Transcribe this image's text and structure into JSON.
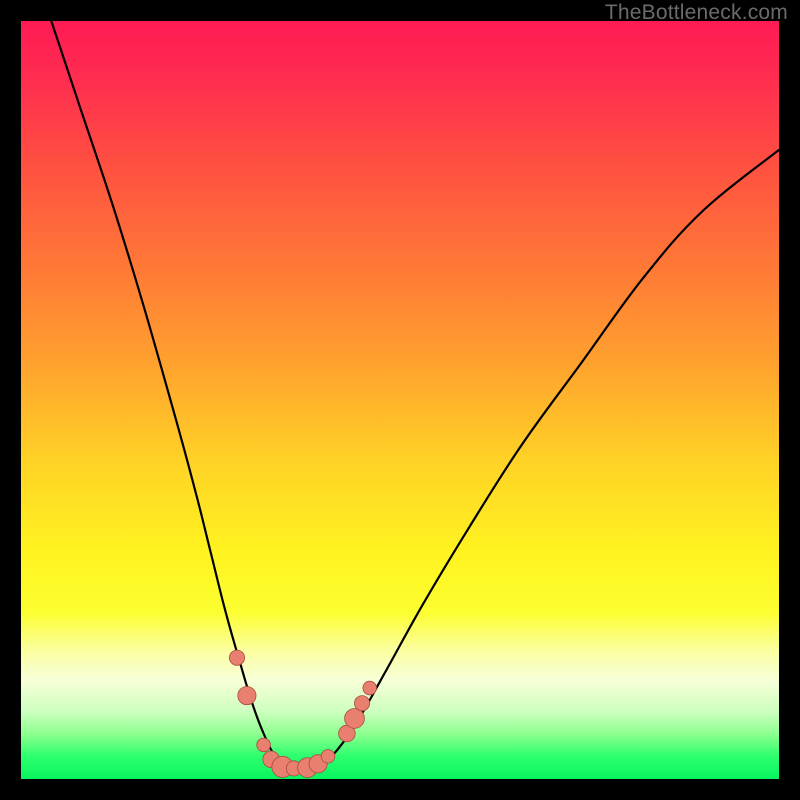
{
  "watermark": "TheBottleneck.com",
  "colors": {
    "frame": "#000000",
    "curve": "#000000",
    "marker_fill": "#e9806f",
    "marker_stroke": "#a84a3d",
    "gradient_stops": [
      "#ff1a54",
      "#ff2e4f",
      "#ff5340",
      "#ff7a36",
      "#ffa12e",
      "#ffd226",
      "#fff320",
      "#fcfe30",
      "#fbffa0",
      "#f7ffd8",
      "#cfffc0",
      "#8fff90",
      "#2dff6e",
      "#07f55f"
    ]
  },
  "chart_data": {
    "type": "line",
    "title": "",
    "xlabel": "",
    "ylabel": "",
    "xlim": [
      0,
      100
    ],
    "ylim": [
      0,
      100
    ],
    "note": "x,y in percent of plot area; y=0 at bottom (green), y=100 at top (red). Background gradient encodes bottleneck severity: green=balanced, red=severe.",
    "series": [
      {
        "name": "bottleneck-curve",
        "x": [
          4,
          8,
          12,
          16,
          20,
          23,
          25,
          27,
          29,
          30.5,
          32,
          33.5,
          35,
          37,
          39,
          41,
          44,
          48,
          53,
          59,
          66,
          74,
          82,
          90,
          100
        ],
        "y": [
          100,
          88,
          76,
          63,
          49,
          38,
          30,
          22,
          15,
          10,
          6,
          3,
          1.5,
          1.3,
          1.5,
          3,
          7,
          14,
          23,
          33,
          44,
          55,
          66,
          75,
          83
        ]
      }
    ],
    "markers": {
      "name": "sample-points",
      "points": [
        {
          "x": 28.5,
          "y": 16,
          "r": 1.0
        },
        {
          "x": 29.8,
          "y": 11,
          "r": 1.2
        },
        {
          "x": 32.0,
          "y": 4.5,
          "r": 0.9
        },
        {
          "x": 33.0,
          "y": 2.6,
          "r": 1.1
        },
        {
          "x": 34.5,
          "y": 1.6,
          "r": 1.4
        },
        {
          "x": 36.0,
          "y": 1.4,
          "r": 1.0
        },
        {
          "x": 37.8,
          "y": 1.5,
          "r": 1.3
        },
        {
          "x": 39.2,
          "y": 2.0,
          "r": 1.2
        },
        {
          "x": 40.5,
          "y": 3.0,
          "r": 0.9
        },
        {
          "x": 43.0,
          "y": 6.0,
          "r": 1.1
        },
        {
          "x": 44.0,
          "y": 8.0,
          "r": 1.3
        },
        {
          "x": 45.0,
          "y": 10.0,
          "r": 1.0
        },
        {
          "x": 46.0,
          "y": 12.0,
          "r": 0.9
        }
      ]
    }
  }
}
